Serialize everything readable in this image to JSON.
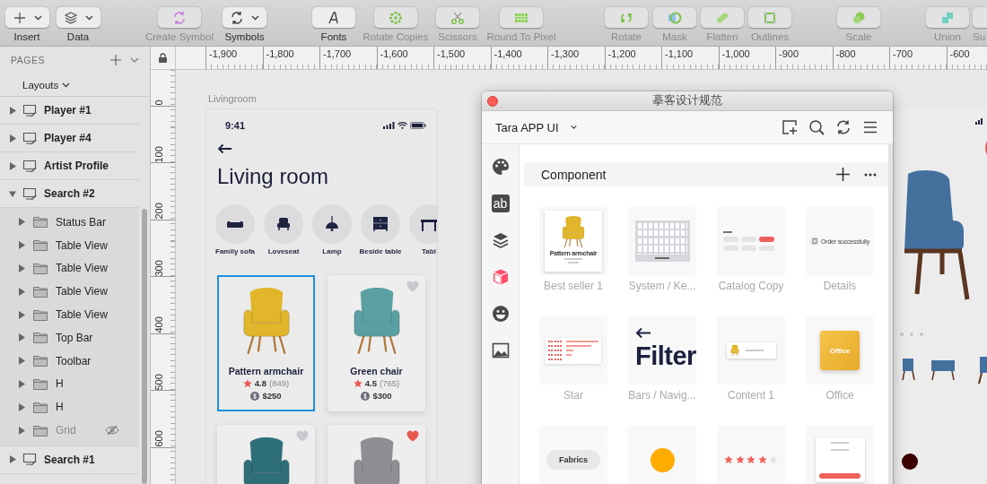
{
  "toolbar": {
    "items": [
      {
        "label": "Insert",
        "kind": "dropdown",
        "disabled": false
      },
      {
        "label": "Data",
        "kind": "dropdown",
        "disabled": false
      },
      {
        "label": "Create Symbol",
        "kind": "button",
        "disabled": true
      },
      {
        "label": "Symbols",
        "kind": "dropdown",
        "disabled": false
      },
      {
        "label": "Fonts",
        "kind": "button",
        "disabled": false
      },
      {
        "label": "Rotate Copies",
        "kind": "button",
        "disabled": true
      },
      {
        "label": "Scissors",
        "kind": "button",
        "disabled": true
      },
      {
        "label": "Round To Pixel",
        "kind": "button",
        "disabled": true
      },
      {
        "label": "Rotate",
        "kind": "button",
        "disabled": true
      },
      {
        "label": "Mask",
        "kind": "button",
        "disabled": true
      },
      {
        "label": "Flatten",
        "kind": "button",
        "disabled": true
      },
      {
        "label": "Outlines",
        "kind": "button",
        "disabled": true
      },
      {
        "label": "Scale",
        "kind": "button",
        "disabled": true
      },
      {
        "label": "Union",
        "kind": "button",
        "disabled": true
      },
      {
        "label": "Su",
        "kind": "button",
        "disabled": true
      }
    ]
  },
  "pages_panel": {
    "title": "PAGES",
    "page_selector": "Layouts",
    "layers": [
      {
        "name": "Player #1",
        "expanded": false
      },
      {
        "name": "Player #4",
        "expanded": false
      },
      {
        "name": "Artist Profile",
        "expanded": false
      },
      {
        "name": "Search #2",
        "expanded": true,
        "children": [
          {
            "name": "Status Bar",
            "hidden": false
          },
          {
            "name": "Table View",
            "hidden": false
          },
          {
            "name": "Table View",
            "hidden": false
          },
          {
            "name": "Table View",
            "hidden": false
          },
          {
            "name": "Table View",
            "hidden": false
          },
          {
            "name": "Top Bar",
            "hidden": false
          },
          {
            "name": "Toolbar",
            "hidden": false
          },
          {
            "name": "H",
            "hidden": false
          },
          {
            "name": "H",
            "hidden": false
          },
          {
            "name": "Grid",
            "hidden": true
          }
        ]
      },
      {
        "name": "Search #1",
        "expanded": false
      }
    ]
  },
  "rulers": {
    "horizontal": [
      "-1,900",
      "-1,800",
      "-1,700",
      "-1,600",
      "-1,500",
      "-1,400",
      "-1,300",
      "-1,200",
      "-1,100",
      "-1,000",
      "-900",
      "-800",
      "-700",
      "-600"
    ],
    "vertical": [
      "0",
      "100",
      "200",
      "300",
      "400",
      "500",
      "600"
    ]
  },
  "artboard": {
    "name": "Livingroom",
    "time": "9:41",
    "title": "Living room",
    "categories": [
      {
        "label": "Family sofa"
      },
      {
        "label": "Loveseat"
      },
      {
        "label": "Lamp"
      },
      {
        "label": "Beside table"
      },
      {
        "label": "Tabl"
      }
    ],
    "products": [
      {
        "name": "Pattern armchair",
        "rating": "4.8",
        "reviews": "(849)",
        "price": "$250",
        "selected": true
      },
      {
        "name": "Green chair",
        "rating": "4.5",
        "reviews": "(765)",
        "price": "$300",
        "selected": false,
        "favorite": false
      },
      {
        "selected": false,
        "favorite": false
      },
      {
        "selected": false,
        "favorite": true
      }
    ]
  },
  "plugin": {
    "title": "摹客设计规范",
    "project": "Tara APP UI",
    "rail": [
      {
        "selected": false
      },
      {
        "glyph": "ab",
        "selected": false
      },
      {
        "selected": false
      },
      {
        "selected": true
      },
      {
        "selected": false
      },
      {
        "selected": false
      }
    ],
    "section": "Component",
    "components": [
      {
        "label": "Best seller 1",
        "kind": "product",
        "text": "Pattern armchair"
      },
      {
        "label": "System / Ke...",
        "kind": "keyboard"
      },
      {
        "label": "Catalog Copy",
        "kind": "chips"
      },
      {
        "label": "Details",
        "kind": "toast",
        "text": "Order successfully"
      },
      {
        "label": "Star",
        "kind": "ratings"
      },
      {
        "label": "Bars / Navig...",
        "kind": "nav",
        "text": "Filter"
      },
      {
        "label": "Content 1",
        "kind": "listitem"
      },
      {
        "label": "Office",
        "kind": "image",
        "text": "Office"
      },
      {
        "kind": "pill",
        "text": "Fabrics"
      },
      {
        "kind": "dot"
      },
      {
        "kind": "stars",
        "stars": 4
      },
      {
        "kind": "form"
      }
    ]
  }
}
